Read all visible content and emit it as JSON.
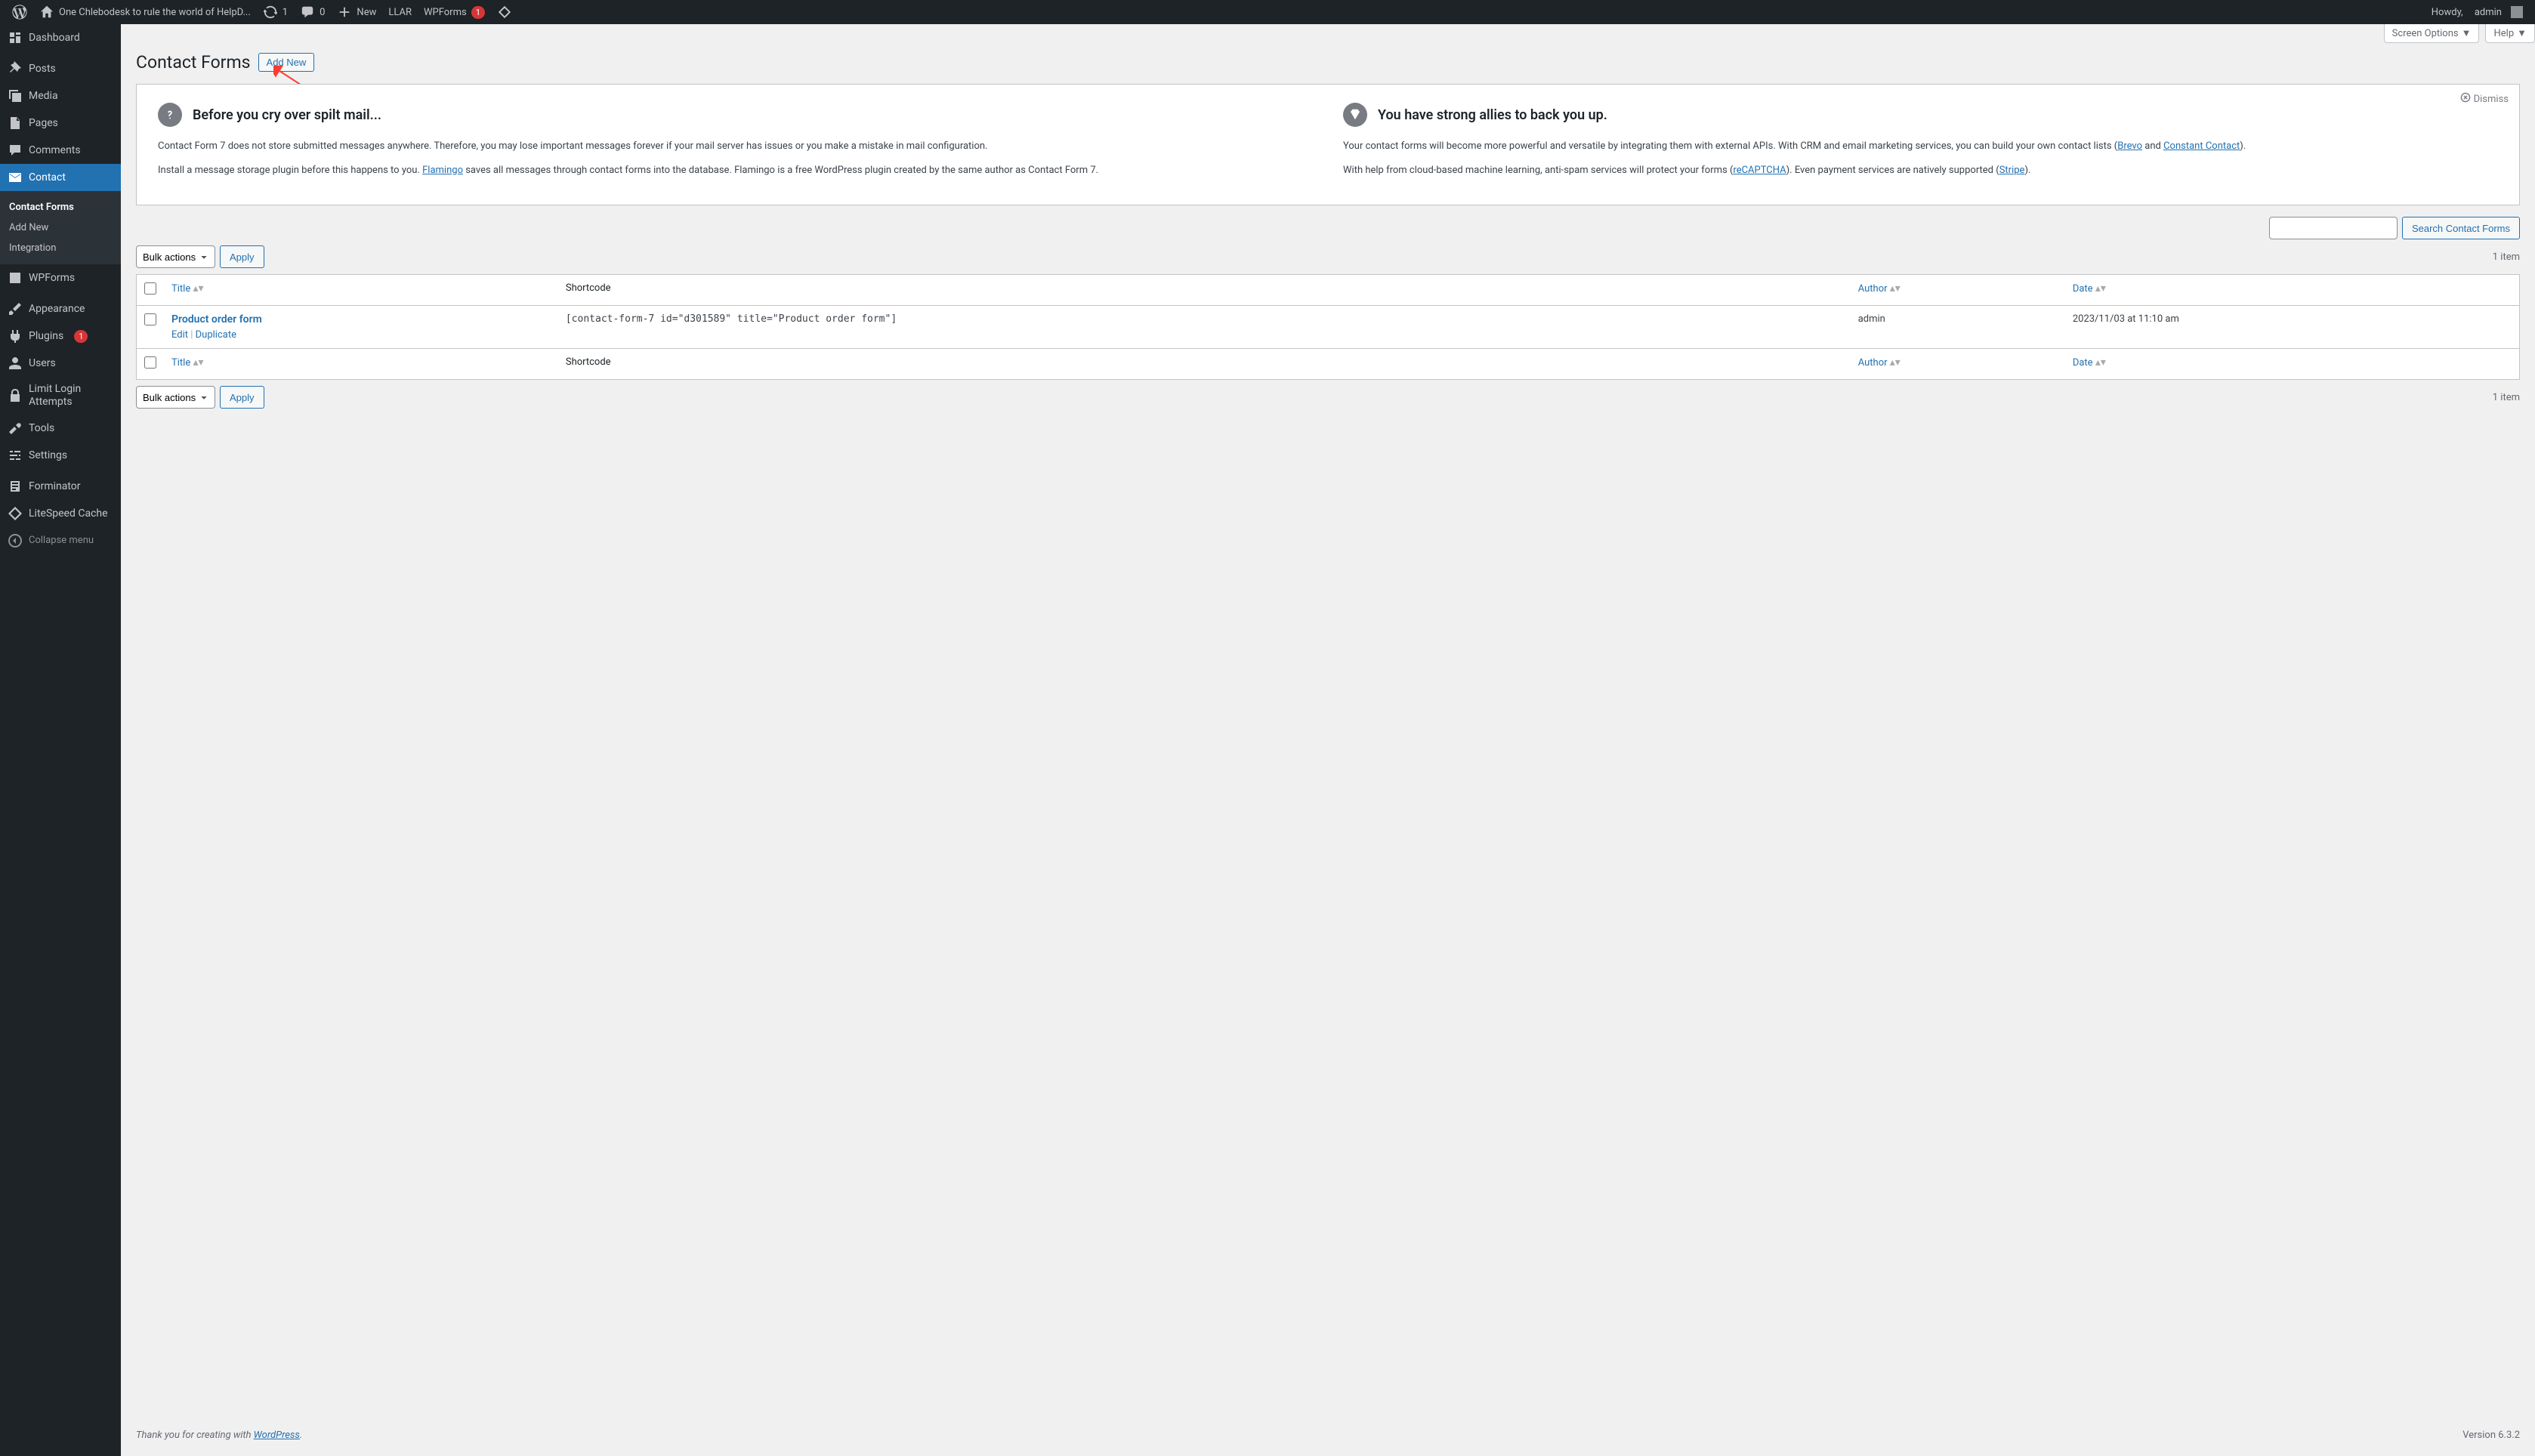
{
  "adminbar": {
    "site_title": "One Chlebodesk to rule the world of HelpD...",
    "refresh_count": "1",
    "comments_count": "0",
    "new_label": "New",
    "llar": "LLAR",
    "wpforms": "WPForms",
    "wpforms_badge": "1",
    "howdy_prefix": "Howdy,",
    "user": "admin"
  },
  "sidebar": {
    "items": [
      {
        "label": "Dashboard",
        "icon": "dashboard"
      },
      {
        "label": "Posts",
        "icon": "pin"
      },
      {
        "label": "Media",
        "icon": "media"
      },
      {
        "label": "Pages",
        "icon": "page"
      },
      {
        "label": "Comments",
        "icon": "comment"
      },
      {
        "label": "Contact",
        "icon": "mail",
        "active": true,
        "sub": [
          {
            "label": "Contact Forms",
            "current": true
          },
          {
            "label": "Add New"
          },
          {
            "label": "Integration"
          }
        ]
      },
      {
        "label": "WPForms",
        "icon": "wpforms"
      },
      {
        "label": "Appearance",
        "icon": "brush"
      },
      {
        "label": "Plugins",
        "icon": "plugin",
        "badge": "1"
      },
      {
        "label": "Users",
        "icon": "user"
      },
      {
        "label": "Limit Login Attempts",
        "icon": "limit"
      },
      {
        "label": "Tools",
        "icon": "wrench"
      },
      {
        "label": "Settings",
        "icon": "sliders"
      },
      {
        "label": "Forminator",
        "icon": "form"
      },
      {
        "label": "LiteSpeed Cache",
        "icon": "litespeed"
      }
    ],
    "collapse": "Collapse menu"
  },
  "screen": {
    "options": "Screen Options",
    "help": "Help"
  },
  "page": {
    "title": "Contact Forms",
    "add_new": "Add New"
  },
  "notice": {
    "dismiss": "Dismiss",
    "col1": {
      "title": "Before you cry over spilt mail...",
      "p1a": "Contact Form 7 does not store submitted messages anywhere. Therefore, you may lose important messages forever if your mail server has issues or you make a mistake in mail configuration.",
      "p2a": "Install a message storage plugin before this happens to you. ",
      "p2link": "Flamingo",
      "p2b": " saves all messages through contact forms into the database. Flamingo is a free WordPress plugin created by the same author as Contact Form 7."
    },
    "col2": {
      "title": "You have strong allies to back you up.",
      "p1a": "Your contact forms will become more powerful and versatile by integrating them with external APIs. With CRM and email marketing services, you can build your own contact lists (",
      "p1link1": "Brevo",
      "p1mid": " and ",
      "p1link2": "Constant Contact",
      "p1b": ").",
      "p2a": "With help from cloud-based machine learning, anti-spam services will protect your forms (",
      "p2link1": "reCAPTCHA",
      "p2mid": "). Even payment services are natively supported (",
      "p2link2": "Stripe",
      "p2b": ")."
    }
  },
  "search": {
    "button": "Search Contact Forms"
  },
  "bulk": {
    "label": "Bulk actions",
    "apply": "Apply"
  },
  "count": "1 item",
  "table": {
    "cols": {
      "title": "Title",
      "shortcode": "Shortcode",
      "author": "Author",
      "date": "Date"
    },
    "rows": [
      {
        "title": "Product order form",
        "shortcode": "[contact-form-7 id=\"d301589\" title=\"Product order form\"]",
        "author": "admin",
        "date": "2023/11/03 at 11:10 am",
        "actions": {
          "edit": "Edit",
          "duplicate": "Duplicate"
        }
      }
    ]
  },
  "footer": {
    "thanks_prefix": "Thank you for creating with ",
    "wp": "WordPress",
    "version": "Version 6.3.2"
  }
}
